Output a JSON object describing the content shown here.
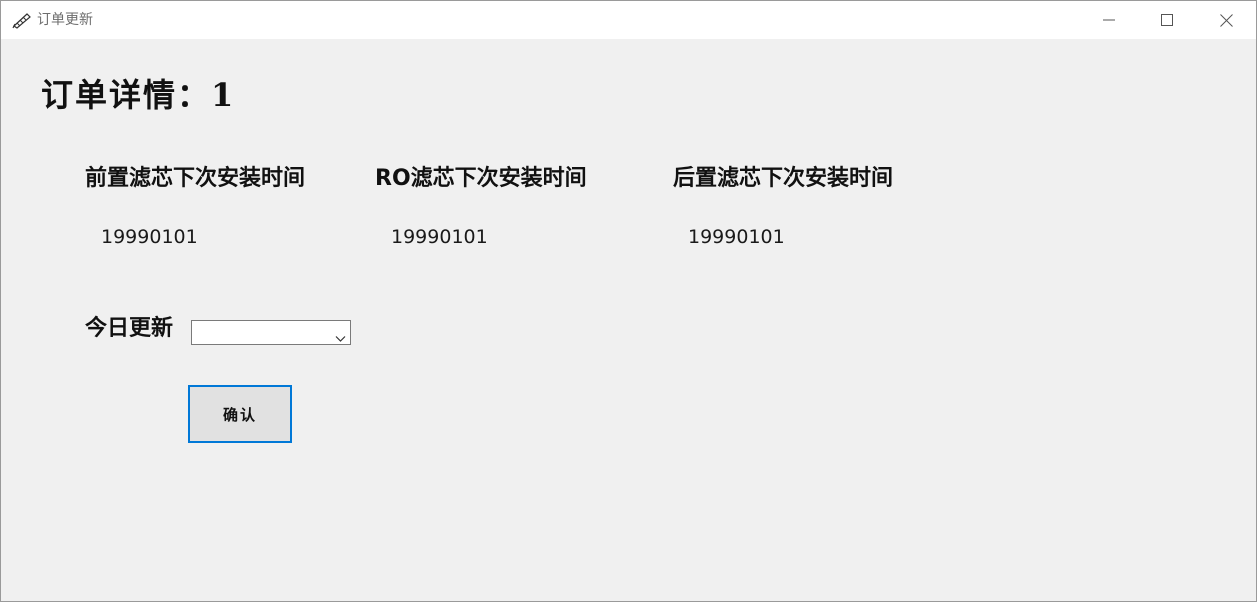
{
  "window": {
    "title": "订单更新",
    "icon": "pencil-ruler-icon",
    "controls": [
      "minimize-icon",
      "maximize-icon",
      "close-icon"
    ]
  },
  "heading": "订单详情：1",
  "filters": [
    {
      "label": "前置滤芯下次安装时间",
      "value": "19990101"
    },
    {
      "label": "RO滤芯下次安装时间",
      "value": "19990101"
    },
    {
      "label": "后置滤芯下次安装时间",
      "value": "19990101"
    }
  ],
  "today_update": {
    "label": "今日更新",
    "selected": ""
  },
  "confirm_button": {
    "label": "确认",
    "accent": "#0078d7"
  },
  "colors": {
    "background": "#f0f0f0",
    "titlebar": "#ffffff"
  }
}
